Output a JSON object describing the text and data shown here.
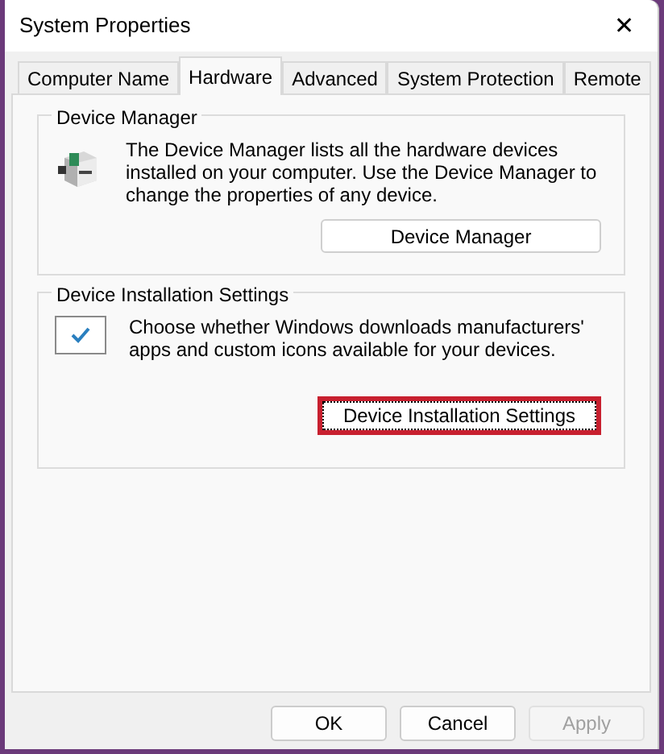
{
  "window": {
    "title": "System Properties",
    "close": "✕"
  },
  "tabs": [
    {
      "label": "Computer Name",
      "selected": false
    },
    {
      "label": "Hardware",
      "selected": true
    },
    {
      "label": "Advanced",
      "selected": false
    },
    {
      "label": "System Protection",
      "selected": false
    },
    {
      "label": "Remote",
      "selected": false
    }
  ],
  "groups": [
    {
      "title": "Device Manager",
      "kind": "device",
      "description": "The Device Manager lists all the hardware devices installed on your computer. Use the Device Manager to change the properties of any device.",
      "button": {
        "label": "Device Manager",
        "highlighted": false
      }
    },
    {
      "title": "Device Installation Settings",
      "kind": "check",
      "description": "Choose whether Windows downloads manufacturers' apps and custom icons available for your devices.",
      "button": {
        "label": "Device Installation Settings",
        "highlighted": true
      }
    }
  ],
  "buttons": [
    {
      "label": "OK",
      "disabled": false
    },
    {
      "label": "Cancel",
      "disabled": false
    },
    {
      "label": "Apply",
      "disabled": true
    }
  ]
}
